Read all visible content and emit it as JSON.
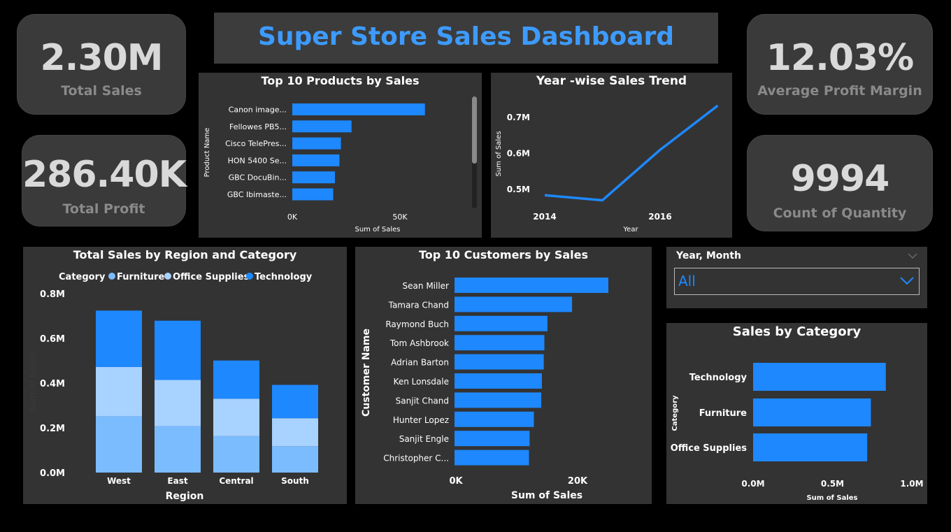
{
  "title": "Super Store Sales Dashboard",
  "kpis": {
    "total_sales": {
      "value": "2.30M",
      "label": "Total Sales"
    },
    "total_profit": {
      "value": "286.40K",
      "label": "Total Profit"
    },
    "avg_margin": {
      "value": "12.03%",
      "label": "Average Profit Margin"
    },
    "count_qty": {
      "value": "9994",
      "label": "Count of Quantity"
    }
  },
  "colors": {
    "accent": "#1e88ff",
    "furniture": "#7bbcff",
    "office_supplies": "#a8d2ff",
    "technology": "#1e88ff",
    "title_text": "#3d9bff",
    "panel": "#333333"
  },
  "slicer": {
    "label": "Year, Month",
    "value": "All"
  },
  "chart_data": [
    {
      "id": "top_products",
      "type": "bar",
      "orientation": "horizontal",
      "title": "Top 10 Products by Sales",
      "xlabel": "Sum of Sales",
      "ylabel": "Product Name",
      "categories": [
        "Canon image...",
        "Fellowes PB5...",
        "Cisco TelePres...",
        "HON 5400 Se...",
        "GBC DocuBin...",
        "GBC Ibimaste..."
      ],
      "values": [
        61600,
        27500,
        22600,
        21900,
        19800,
        19000
      ],
      "xticks": [
        "0K",
        "50K"
      ],
      "xlim": [
        0,
        80000
      ]
    },
    {
      "id": "year_trend",
      "type": "line",
      "title": "Year -wise Sales Trend",
      "xlabel": "Year",
      "ylabel": "Sum of Sales",
      "x": [
        2014,
        2015,
        2016,
        2017
      ],
      "values": [
        484000,
        470000,
        610000,
        733000
      ],
      "xticks": [
        "2014",
        "2016"
      ],
      "yticks": [
        "0.5M",
        "0.6M",
        "0.7M"
      ]
    },
    {
      "id": "region_category",
      "type": "bar",
      "stacked": true,
      "title": "Total Sales by Region and Category",
      "xlabel": "Region",
      "ylabel": "Sum of Sales",
      "legend_title": "Category",
      "categories": [
        "West",
        "East",
        "Central",
        "South"
      ],
      "series": [
        {
          "name": "Furniture",
          "values": [
            252000,
            208000,
            163000,
            118000
          ]
        },
        {
          "name": "Office Supplies",
          "values": [
            220000,
            206000,
            167000,
            125000
          ]
        },
        {
          "name": "Technology",
          "values": [
            252000,
            265000,
            171000,
            149000
          ]
        }
      ],
      "yticks": [
        "0.0M",
        "0.2M",
        "0.4M",
        "0.6M",
        "0.8M"
      ],
      "ylim": [
        0,
        800000
      ]
    },
    {
      "id": "top_customers",
      "type": "bar",
      "orientation": "horizontal",
      "title": "Top 10 Customers by Sales",
      "xlabel": "Sum of Sales",
      "ylabel": "Customer Name",
      "categories": [
        "Sean Miller",
        "Tamara Chand",
        "Raymond Buch",
        "Tom Ashbrook",
        "Adrian Barton",
        "Ken Lonsdale",
        "Sanjit Chand",
        "Hunter Lopez",
        "Sanjit Engle",
        "Christopher C..."
      ],
      "values": [
        25000,
        19100,
        15100,
        14600,
        14500,
        14200,
        14100,
        12900,
        12200,
        12100
      ],
      "xticks": [
        "0K",
        "20K"
      ],
      "xlim": [
        0,
        30000
      ]
    },
    {
      "id": "sales_by_category",
      "type": "bar",
      "orientation": "horizontal",
      "title": "Sales by Category",
      "xlabel": "Sum of Sales",
      "ylabel": "Category",
      "categories": [
        "Technology",
        "Furniture",
        "Office Supplies"
      ],
      "values": [
        836000,
        742000,
        719000
      ],
      "xticks": [
        "0.0M",
        "0.5M",
        "1.0M"
      ],
      "xlim": [
        0,
        1000000
      ]
    }
  ]
}
